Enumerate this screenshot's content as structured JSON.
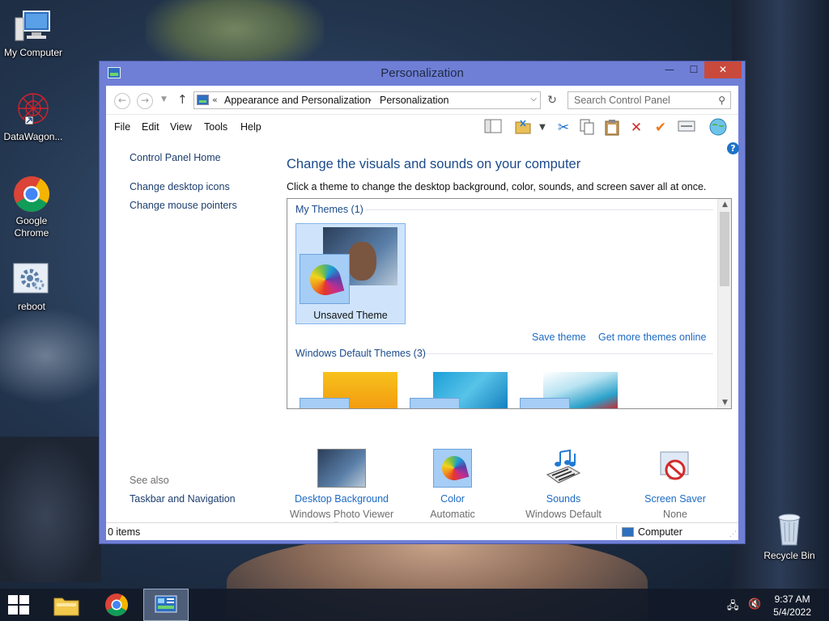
{
  "desktop": {
    "icons": [
      {
        "label": "My Computer"
      },
      {
        "label": "DataWagon..."
      },
      {
        "label": "Google Chrome"
      },
      {
        "label": "reboot"
      },
      {
        "label": "Recycle Bin"
      }
    ]
  },
  "window": {
    "title": "Personalization",
    "controls": {
      "minimize": "—",
      "maximize": "☐",
      "close": "✕"
    }
  },
  "address": {
    "prefix": "«",
    "crumbs": [
      "Appearance and Personalization",
      "Personalization"
    ],
    "search_placeholder": "Search Control Panel"
  },
  "menu": [
    "File",
    "Edit",
    "View",
    "Tools",
    "Help"
  ],
  "left_pane": {
    "home": "Control Panel Home",
    "links": [
      "Change desktop icons",
      "Change mouse pointers"
    ],
    "see_also_label": "See also",
    "see_also": [
      "Taskbar and Navigation"
    ]
  },
  "main": {
    "heading": "Change the visuals and sounds on your computer",
    "subtext": "Click a theme to change the desktop background, color, sounds, and screen saver all at once.",
    "my_themes": "My Themes (1)",
    "selected_theme": "Unsaved Theme",
    "save_theme": "Save theme",
    "get_more": "Get more themes online",
    "default_themes": "Windows Default Themes (3)"
  },
  "bottom": [
    {
      "title": "Desktop Background",
      "sub": "Windows Photo Viewer Wallpaper"
    },
    {
      "title": "Color",
      "sub": "Automatic"
    },
    {
      "title": "Sounds",
      "sub": "Windows Default"
    },
    {
      "title": "Screen Saver",
      "sub": "None"
    }
  ],
  "status": {
    "items": "0 items",
    "location": "Computer"
  },
  "taskbar": {
    "time": "9:37 AM",
    "date": "5/4/2022"
  },
  "colors": {
    "titlebar": "#6f7fd6",
    "close": "#c94a3c",
    "link": "#1d6ac4",
    "heading": "#1b4a8a"
  }
}
